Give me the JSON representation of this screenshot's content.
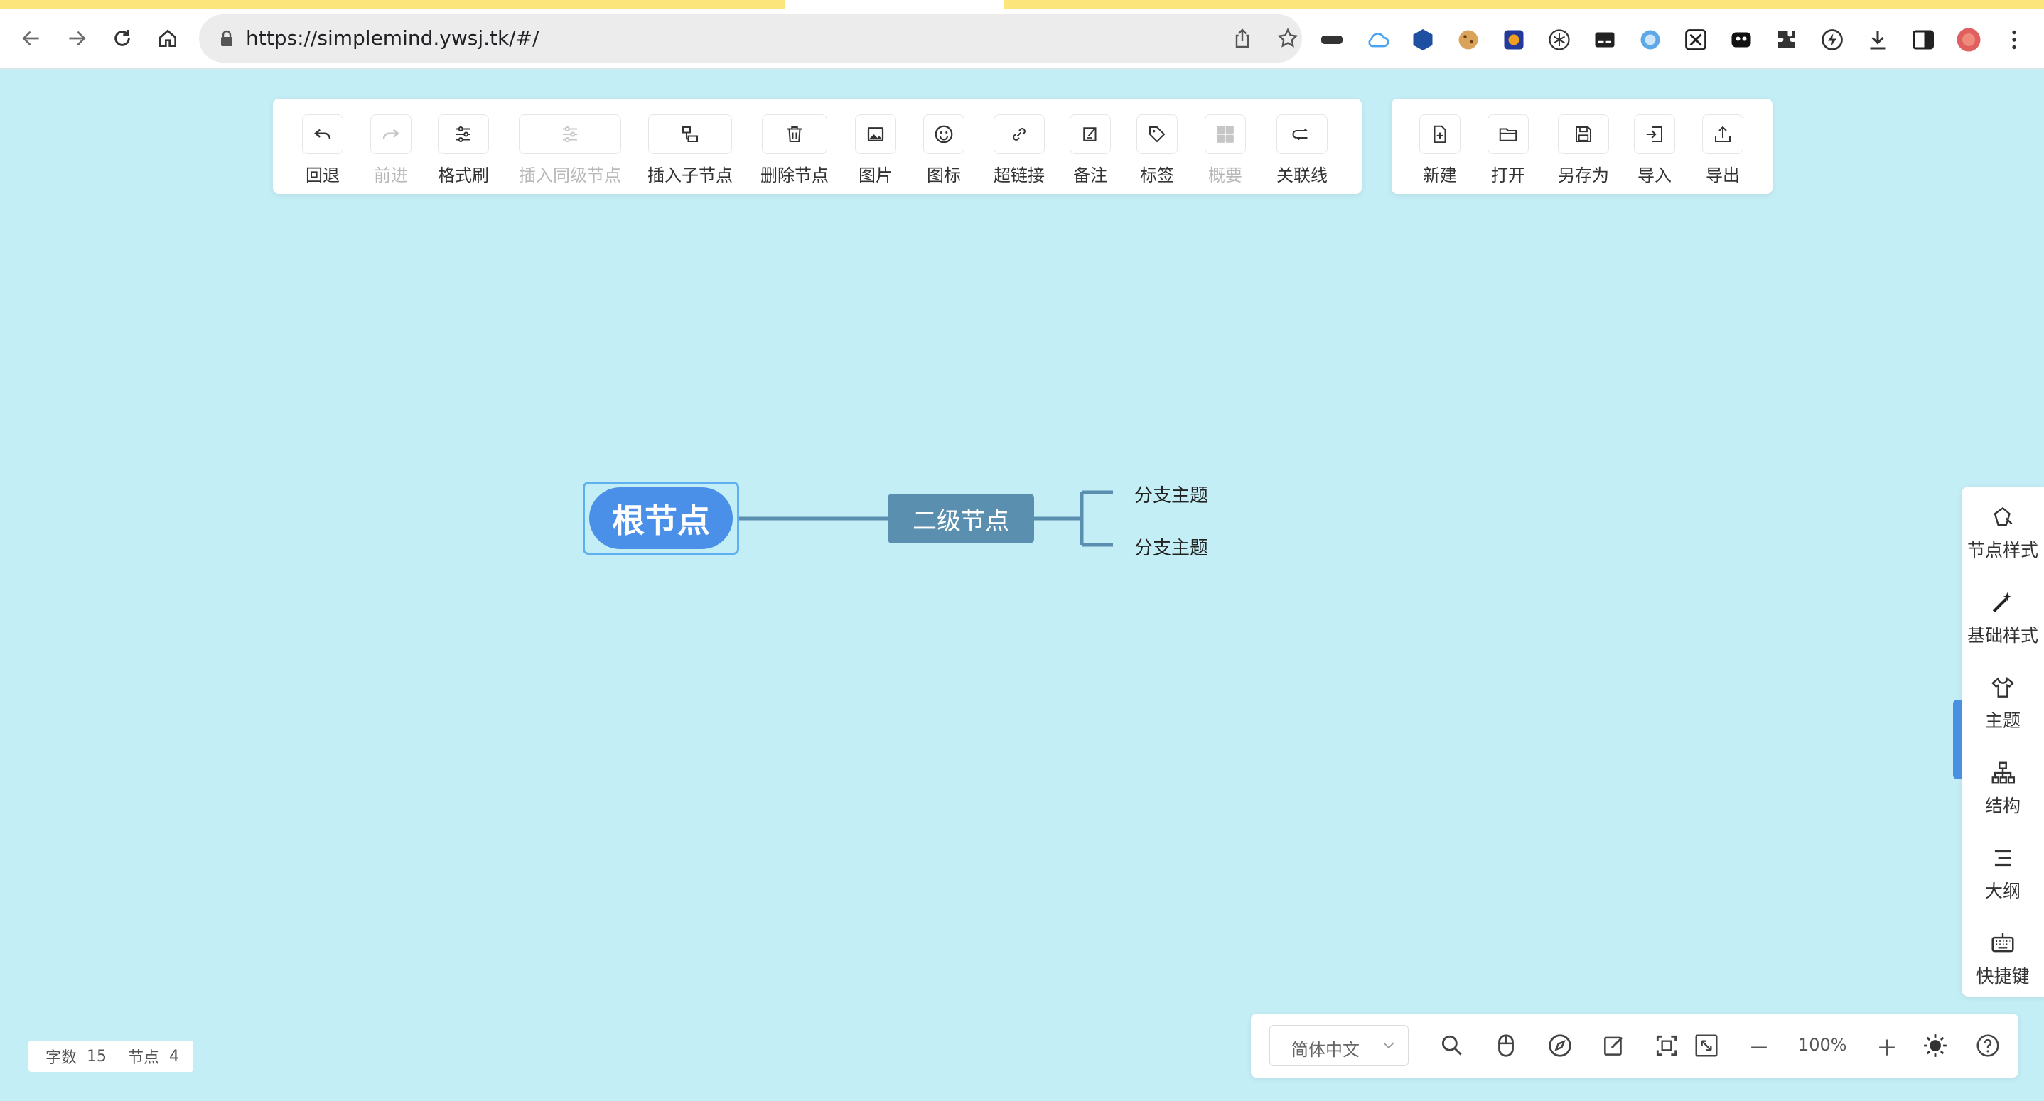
{
  "browser": {
    "url": "https://simplemind.ywsj.tk/#/"
  },
  "toolbar_main": [
    {
      "id": "undo",
      "label": "回退",
      "enabled": true,
      "icon": "undo-icon"
    },
    {
      "id": "redo",
      "label": "前进",
      "enabled": false,
      "icon": "redo-icon"
    },
    {
      "id": "format-painter",
      "label": "格式刷",
      "enabled": true,
      "icon": "sliders-icon"
    },
    {
      "id": "insert-sibling",
      "label": "插入同级节点",
      "enabled": false,
      "icon": "sibling-node-icon"
    },
    {
      "id": "insert-child",
      "label": "插入子节点",
      "enabled": true,
      "icon": "child-node-icon"
    },
    {
      "id": "delete-node",
      "label": "删除节点",
      "enabled": true,
      "icon": "trash-icon"
    },
    {
      "id": "image",
      "label": "图片",
      "enabled": true,
      "icon": "image-icon"
    },
    {
      "id": "icon",
      "label": "图标",
      "enabled": true,
      "icon": "smiley-icon"
    },
    {
      "id": "hyperlink",
      "label": "超链接",
      "enabled": true,
      "icon": "link-icon"
    },
    {
      "id": "note",
      "label": "备注",
      "enabled": true,
      "icon": "note-icon"
    },
    {
      "id": "tag",
      "label": "标签",
      "enabled": true,
      "icon": "tag-icon"
    },
    {
      "id": "summary",
      "label": "概要",
      "enabled": false,
      "icon": "summary-grid-icon"
    },
    {
      "id": "association",
      "label": "关联线",
      "enabled": true,
      "icon": "association-line-icon"
    }
  ],
  "toolbar_file": [
    {
      "id": "new",
      "label": "新建",
      "icon": "new-file-icon"
    },
    {
      "id": "open",
      "label": "打开",
      "icon": "folder-icon"
    },
    {
      "id": "save-as",
      "label": "另存为",
      "icon": "save-icon"
    },
    {
      "id": "import",
      "label": "导入",
      "icon": "import-icon"
    },
    {
      "id": "export",
      "label": "导出",
      "icon": "export-icon"
    }
  ],
  "mindmap": {
    "root": "根节点",
    "second": "二级节点",
    "branches": [
      "分支主题",
      "分支主题"
    ],
    "colors": {
      "root": "#4a8fe8",
      "second": "#5a8fb0",
      "line": "#5a8fb0",
      "canvas": "#c4eef6"
    }
  },
  "sidebar": [
    {
      "id": "node-style",
      "label": "节点样式",
      "icon": "node-style-icon"
    },
    {
      "id": "base-style",
      "label": "基础样式",
      "icon": "magic-wand-icon"
    },
    {
      "id": "theme",
      "label": "主题",
      "icon": "shirt-icon"
    },
    {
      "id": "structure",
      "label": "结构",
      "icon": "structure-icon"
    },
    {
      "id": "outline",
      "label": "大纲",
      "icon": "outline-icon"
    },
    {
      "id": "shortcut",
      "label": "快捷键",
      "icon": "keyboard-icon"
    }
  ],
  "status": {
    "word_count_label": "字数",
    "word_count": "15",
    "node_count_label": "节点",
    "node_count": "4"
  },
  "bottom": {
    "language": "简体中文",
    "zoom": "100%",
    "minus": "－",
    "plus": "＋"
  }
}
